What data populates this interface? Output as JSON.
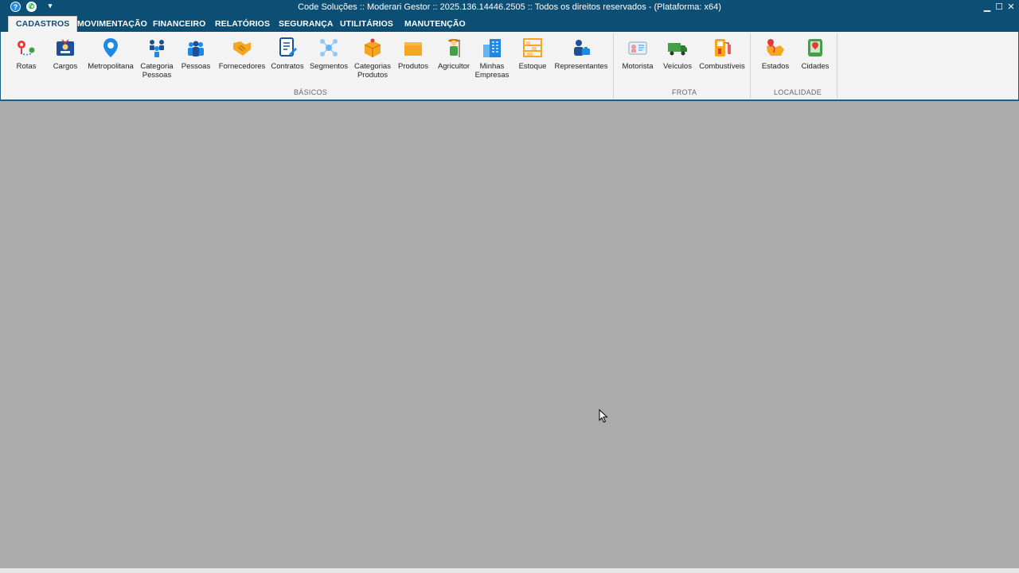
{
  "window": {
    "title": "Code Soluções :: Moderari Gestor :: 2025.136.14446.2505 :: Todos os direitos reservados - (Plataforma: x64)",
    "quick_access": [
      "help-icon",
      "whatsapp-icon",
      "customize-icon"
    ],
    "controls": {
      "minimize": "▁",
      "maximize": "☐",
      "close": "✕"
    }
  },
  "tabs": [
    {
      "label": "CADASTROS",
      "active": true
    },
    {
      "label": "MOVIMENTAÇÃO"
    },
    {
      "label": "FINANCEIRO"
    },
    {
      "label": "RELATÓRIOS"
    },
    {
      "label": "SEGURANÇA"
    },
    {
      "label": "UTILITÁRIOS"
    },
    {
      "label": "MANUTENÇÃO"
    }
  ],
  "groups": [
    {
      "label": "BÁSICOS",
      "buttons": [
        {
          "label": "Rotas",
          "icon": "route-pin-icon"
        },
        {
          "label": "Cargos",
          "icon": "id-card-icon"
        },
        {
          "label": "Metropolitana",
          "icon": "map-pin-icon"
        },
        {
          "label": "Categoria\nPessoas",
          "icon": "people-group-icon"
        },
        {
          "label": "Pessoas",
          "icon": "people-icon"
        },
        {
          "label": "Fornecedores",
          "icon": "handshake-icon"
        },
        {
          "label": "Contratos",
          "icon": "contract-icon"
        },
        {
          "label": "Segmentos",
          "icon": "network-icon"
        },
        {
          "label": "Categorias\nProdutos",
          "icon": "box-category-icon"
        },
        {
          "label": "Produtos",
          "icon": "box-icon"
        },
        {
          "label": "Agricultor",
          "icon": "farmer-icon"
        },
        {
          "label": "Minhas\nEmpresas",
          "icon": "building-icon"
        },
        {
          "label": "Estoque",
          "icon": "shelf-icon"
        },
        {
          "label": "Representantes",
          "icon": "representative-icon"
        }
      ]
    },
    {
      "label": "FROTA",
      "buttons": [
        {
          "label": "Motorista",
          "icon": "driver-license-icon"
        },
        {
          "label": "Veículos",
          "icon": "truck-icon"
        },
        {
          "label": "Combustíveis",
          "icon": "fuel-pump-icon"
        }
      ]
    },
    {
      "label": "LOCALIDADE",
      "buttons": [
        {
          "label": "Estados",
          "icon": "state-map-icon"
        },
        {
          "label": "Cidades",
          "icon": "city-map-icon"
        }
      ]
    }
  ],
  "colors": {
    "titlebar": "#0d4f74",
    "ribbon": "#f3f3f3",
    "workspace": "#ababab"
  }
}
